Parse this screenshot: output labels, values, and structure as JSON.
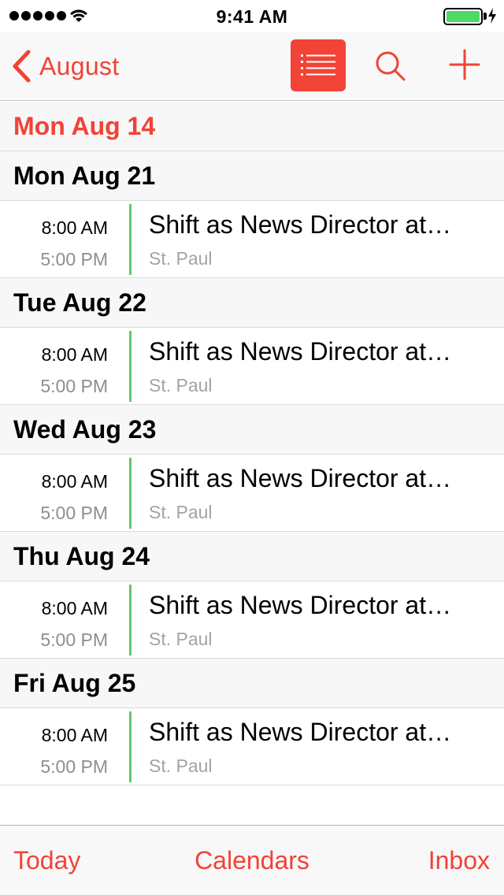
{
  "status_bar": {
    "time": "9:41 AM",
    "signal_bars": 5,
    "battery_level": 1.0
  },
  "nav": {
    "back_label": "August",
    "accent_color": "#f14336"
  },
  "days": [
    {
      "header": "Mon  Aug 14",
      "is_today": true,
      "events": []
    },
    {
      "header": "Mon  Aug 21",
      "is_today": false,
      "events": [
        {
          "start": "8:00 AM",
          "end": "5:00 PM",
          "title": "Shift as News Director at…",
          "location": "St. Paul"
        }
      ]
    },
    {
      "header": "Tue  Aug 22",
      "is_today": false,
      "events": [
        {
          "start": "8:00 AM",
          "end": "5:00 PM",
          "title": "Shift as News Director at…",
          "location": "St. Paul"
        }
      ]
    },
    {
      "header": "Wed  Aug 23",
      "is_today": false,
      "events": [
        {
          "start": "8:00 AM",
          "end": "5:00 PM",
          "title": "Shift as News Director at…",
          "location": "St. Paul"
        }
      ]
    },
    {
      "header": "Thu  Aug 24",
      "is_today": false,
      "events": [
        {
          "start": "8:00 AM",
          "end": "5:00 PM",
          "title": "Shift as News Director at…",
          "location": "St. Paul"
        }
      ]
    },
    {
      "header": "Fri  Aug 25",
      "is_today": false,
      "events": [
        {
          "start": "8:00 AM",
          "end": "5:00 PM",
          "title": "Shift as News Director at…",
          "location": "St. Paul"
        }
      ]
    }
  ],
  "event_color": "#63c96a",
  "tabs": {
    "today": "Today",
    "calendars": "Calendars",
    "inbox": "Inbox"
  }
}
